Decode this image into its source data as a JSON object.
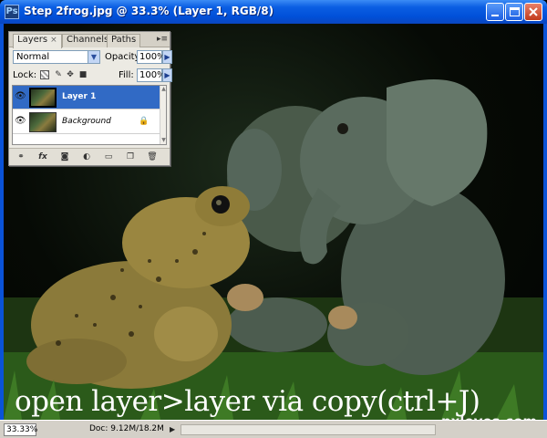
{
  "window": {
    "title": "Step 2frog.jpg @ 33.3% (Layer 1, RGB/8)",
    "app_icon": "Ps"
  },
  "panel": {
    "tabs": [
      {
        "label": "Layers",
        "close": "×"
      },
      {
        "label": "Channels"
      },
      {
        "label": "Paths"
      }
    ],
    "menu_icon": "▸≡",
    "blend_mode": "Normal",
    "opacity_label": "Opacity:",
    "opacity_value": "100%",
    "lock_label": "Lock:",
    "fill_label": "Fill:",
    "fill_value": "100%",
    "layers": [
      {
        "name": "Layer 1",
        "selected": true,
        "visible": true,
        "locked": false
      },
      {
        "name": "Background",
        "selected": false,
        "visible": true,
        "locked": true
      }
    ],
    "footer_icons": [
      "link-icon",
      "fx-icon",
      "mask-icon",
      "adjustment-icon",
      "folder-icon",
      "new-layer-icon",
      "trash-icon"
    ],
    "fx_label": "fx"
  },
  "canvas": {
    "caption": "open layer>layer via copy(ctrl+J)",
    "watermark": "pxleyes.com"
  },
  "status": {
    "zoom": "33.33%",
    "doc": "Doc: 9.12M/18.2M"
  },
  "colors": {
    "titlebar": "#0b5ee3",
    "selection": "#316ac5",
    "panel_bg": "#eceae3"
  }
}
